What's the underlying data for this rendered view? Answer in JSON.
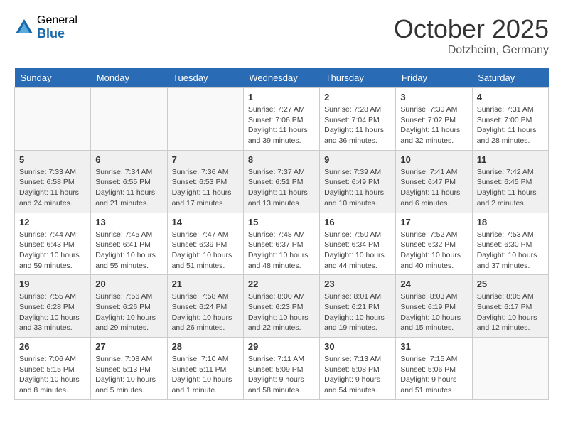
{
  "header": {
    "logo_general": "General",
    "logo_blue": "Blue",
    "month_title": "October 2025",
    "location": "Dotzheim, Germany"
  },
  "weekdays": [
    "Sunday",
    "Monday",
    "Tuesday",
    "Wednesday",
    "Thursday",
    "Friday",
    "Saturday"
  ],
  "weeks": [
    [
      {
        "day": "",
        "info": ""
      },
      {
        "day": "",
        "info": ""
      },
      {
        "day": "",
        "info": ""
      },
      {
        "day": "1",
        "info": "Sunrise: 7:27 AM\nSunset: 7:06 PM\nDaylight: 11 hours\nand 39 minutes."
      },
      {
        "day": "2",
        "info": "Sunrise: 7:28 AM\nSunset: 7:04 PM\nDaylight: 11 hours\nand 36 minutes."
      },
      {
        "day": "3",
        "info": "Sunrise: 7:30 AM\nSunset: 7:02 PM\nDaylight: 11 hours\nand 32 minutes."
      },
      {
        "day": "4",
        "info": "Sunrise: 7:31 AM\nSunset: 7:00 PM\nDaylight: 11 hours\nand 28 minutes."
      }
    ],
    [
      {
        "day": "5",
        "info": "Sunrise: 7:33 AM\nSunset: 6:58 PM\nDaylight: 11 hours\nand 24 minutes."
      },
      {
        "day": "6",
        "info": "Sunrise: 7:34 AM\nSunset: 6:55 PM\nDaylight: 11 hours\nand 21 minutes."
      },
      {
        "day": "7",
        "info": "Sunrise: 7:36 AM\nSunset: 6:53 PM\nDaylight: 11 hours\nand 17 minutes."
      },
      {
        "day": "8",
        "info": "Sunrise: 7:37 AM\nSunset: 6:51 PM\nDaylight: 11 hours\nand 13 minutes."
      },
      {
        "day": "9",
        "info": "Sunrise: 7:39 AM\nSunset: 6:49 PM\nDaylight: 11 hours\nand 10 minutes."
      },
      {
        "day": "10",
        "info": "Sunrise: 7:41 AM\nSunset: 6:47 PM\nDaylight: 11 hours\nand 6 minutes."
      },
      {
        "day": "11",
        "info": "Sunrise: 7:42 AM\nSunset: 6:45 PM\nDaylight: 11 hours\nand 2 minutes."
      }
    ],
    [
      {
        "day": "12",
        "info": "Sunrise: 7:44 AM\nSunset: 6:43 PM\nDaylight: 10 hours\nand 59 minutes."
      },
      {
        "day": "13",
        "info": "Sunrise: 7:45 AM\nSunset: 6:41 PM\nDaylight: 10 hours\nand 55 minutes."
      },
      {
        "day": "14",
        "info": "Sunrise: 7:47 AM\nSunset: 6:39 PM\nDaylight: 10 hours\nand 51 minutes."
      },
      {
        "day": "15",
        "info": "Sunrise: 7:48 AM\nSunset: 6:37 PM\nDaylight: 10 hours\nand 48 minutes."
      },
      {
        "day": "16",
        "info": "Sunrise: 7:50 AM\nSunset: 6:34 PM\nDaylight: 10 hours\nand 44 minutes."
      },
      {
        "day": "17",
        "info": "Sunrise: 7:52 AM\nSunset: 6:32 PM\nDaylight: 10 hours\nand 40 minutes."
      },
      {
        "day": "18",
        "info": "Sunrise: 7:53 AM\nSunset: 6:30 PM\nDaylight: 10 hours\nand 37 minutes."
      }
    ],
    [
      {
        "day": "19",
        "info": "Sunrise: 7:55 AM\nSunset: 6:28 PM\nDaylight: 10 hours\nand 33 minutes."
      },
      {
        "day": "20",
        "info": "Sunrise: 7:56 AM\nSunset: 6:26 PM\nDaylight: 10 hours\nand 29 minutes."
      },
      {
        "day": "21",
        "info": "Sunrise: 7:58 AM\nSunset: 6:24 PM\nDaylight: 10 hours\nand 26 minutes."
      },
      {
        "day": "22",
        "info": "Sunrise: 8:00 AM\nSunset: 6:23 PM\nDaylight: 10 hours\nand 22 minutes."
      },
      {
        "day": "23",
        "info": "Sunrise: 8:01 AM\nSunset: 6:21 PM\nDaylight: 10 hours\nand 19 minutes."
      },
      {
        "day": "24",
        "info": "Sunrise: 8:03 AM\nSunset: 6:19 PM\nDaylight: 10 hours\nand 15 minutes."
      },
      {
        "day": "25",
        "info": "Sunrise: 8:05 AM\nSunset: 6:17 PM\nDaylight: 10 hours\nand 12 minutes."
      }
    ],
    [
      {
        "day": "26",
        "info": "Sunrise: 7:06 AM\nSunset: 5:15 PM\nDaylight: 10 hours\nand 8 minutes."
      },
      {
        "day": "27",
        "info": "Sunrise: 7:08 AM\nSunset: 5:13 PM\nDaylight: 10 hours\nand 5 minutes."
      },
      {
        "day": "28",
        "info": "Sunrise: 7:10 AM\nSunset: 5:11 PM\nDaylight: 10 hours\nand 1 minute."
      },
      {
        "day": "29",
        "info": "Sunrise: 7:11 AM\nSunset: 5:09 PM\nDaylight: 9 hours\nand 58 minutes."
      },
      {
        "day": "30",
        "info": "Sunrise: 7:13 AM\nSunset: 5:08 PM\nDaylight: 9 hours\nand 54 minutes."
      },
      {
        "day": "31",
        "info": "Sunrise: 7:15 AM\nSunset: 5:06 PM\nDaylight: 9 hours\nand 51 minutes."
      },
      {
        "day": "",
        "info": ""
      }
    ]
  ]
}
